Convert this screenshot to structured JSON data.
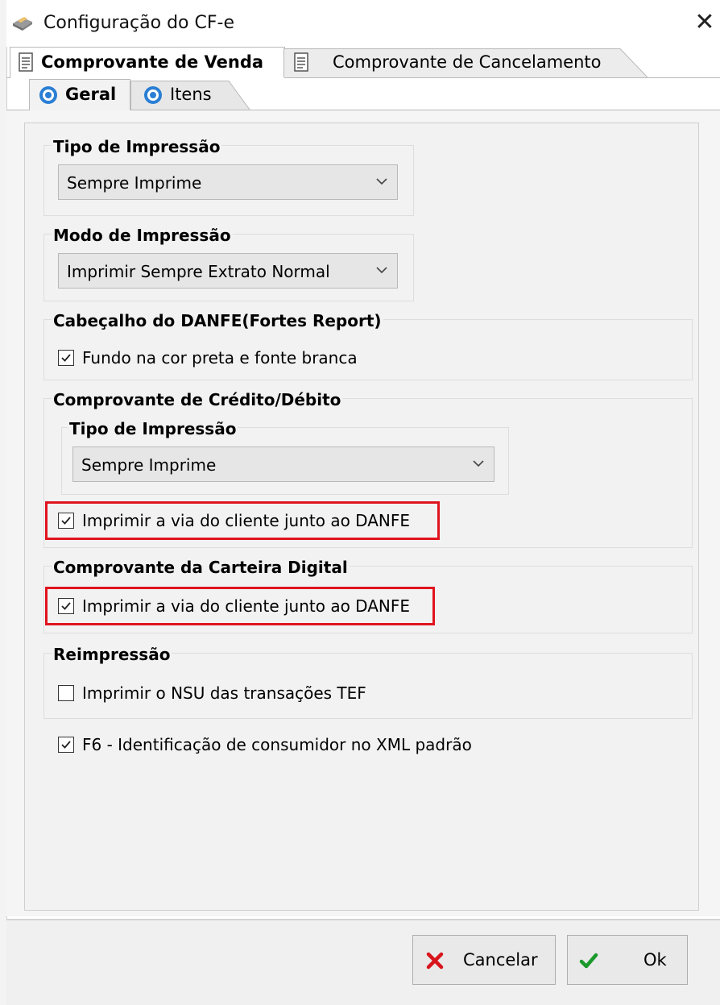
{
  "window": {
    "title": "Configuração do CF-e",
    "close_glyph": "✕"
  },
  "outer_tabs": [
    {
      "label": "Comprovante de Venda",
      "active": true,
      "icon": "document-icon"
    },
    {
      "label": "Comprovante de Cancelamento",
      "active": false,
      "icon": "document-icon"
    }
  ],
  "inner_tabs": [
    {
      "label": "Geral",
      "active": true,
      "icon": "gear-icon"
    },
    {
      "label": "Itens",
      "active": false,
      "icon": "gear-icon"
    }
  ],
  "tipo_impressao": {
    "label": "Tipo de Impressão",
    "value": "Sempre Imprime"
  },
  "modo_impressao": {
    "label": "Modo de Impressão",
    "value": "Imprimir Sempre Extrato Normal"
  },
  "cabecalho": {
    "label": "Cabeçalho do DANFE(Fortes Report)",
    "checkbox": {
      "label": "Fundo na cor preta e fonte branca",
      "checked": true
    }
  },
  "credito_debito": {
    "label": "Comprovante de Crédito/Débito",
    "tipo_label": "Tipo de Impressão",
    "tipo_value": "Sempre Imprime",
    "checkbox": {
      "label": "Imprimir a via do cliente junto ao DANFE",
      "checked": true
    }
  },
  "carteira_digital": {
    "label": "Comprovante da Carteira Digital",
    "checkbox": {
      "label": "Imprimir a via do cliente junto ao DANFE",
      "checked": true
    }
  },
  "reimpressao": {
    "label": "Reimpressão",
    "checkbox": {
      "label": "Imprimir o NSU das transações TEF",
      "checked": false
    }
  },
  "f6": {
    "label": "F6 - Identificação de consumidor no XML padrão",
    "checked": true
  },
  "buttons": {
    "cancel_label": "Cancelar",
    "ok_label": "Ok"
  },
  "colors": {
    "highlight": "#e0141e",
    "cancel_icon": "#d8141c",
    "ok_icon": "#1a9a2a",
    "gear": "#2a7fd4"
  }
}
